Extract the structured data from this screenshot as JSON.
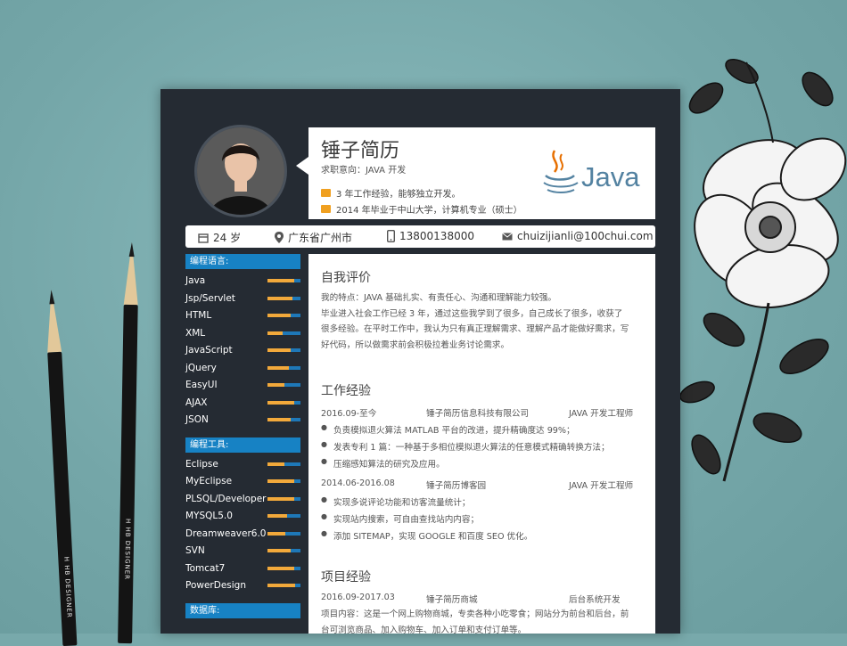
{
  "header": {
    "name": "锤子简历",
    "intent": "求职意向：JAVA 开发",
    "highlights": [
      "3 年工作经验，能够独立开发。",
      "2014 年毕业于中山大学，计算机专业（硕士）"
    ],
    "logo_text": "Java"
  },
  "contact": {
    "age": "24 岁",
    "location": "广东省广州市",
    "phone": "13800138000",
    "email": "chuizijianli@100chui.com"
  },
  "skills": [
    {
      "title": "编程语言:",
      "items": [
        {
          "name": "Java",
          "level": 0.8
        },
        {
          "name": "Jsp/Servlet",
          "level": 0.75
        },
        {
          "name": "HTML",
          "level": 0.7
        },
        {
          "name": "XML",
          "level": 0.45
        },
        {
          "name": "JavaScript",
          "level": 0.7
        },
        {
          "name": "jQuery",
          "level": 0.65
        },
        {
          "name": "EasyUI",
          "level": 0.5
        },
        {
          "name": "AJAX",
          "level": 0.8
        },
        {
          "name": "JSON",
          "level": 0.7
        }
      ]
    },
    {
      "title": "编程工具:",
      "items": [
        {
          "name": "Eclipse",
          "level": 0.5
        },
        {
          "name": "MyEclipse",
          "level": 0.8
        },
        {
          "name": "PLSQL/Developer",
          "level": 0.8
        },
        {
          "name": "MYSQL5.0",
          "level": 0.6
        },
        {
          "name": "Dreamweaver6.0",
          "level": 0.55
        },
        {
          "name": "SVN",
          "level": 0.7
        },
        {
          "name": "Tomcat7",
          "level": 0.8
        },
        {
          "name": "PowerDesign",
          "level": 0.85
        }
      ]
    },
    {
      "title": "数据库:",
      "items": []
    }
  ],
  "self_eval": {
    "title": "自我评价",
    "lines": [
      "我的特点：JAVA 基础扎实、有责任心、沟通和理解能力较强。",
      "毕业进入社会工作已经 3 年，通过这些我学到了很多，自己成长了很多，收获了",
      "很多经验。在平时工作中，我认为只有真正理解需求、理解产品才能做好需求，写",
      "好代码，所以做需求前会积极拉着业务讨论需求。"
    ]
  },
  "work": {
    "title": "工作经验",
    "jobs": [
      {
        "period": "2016.09-至今",
        "company": "锤子简历信息科技有限公司",
        "role": "JAVA 开发工程师",
        "bullets": [
          "负责模拟退火算法 MATLAB 平台的改进，提升精确度达 99%；",
          "发表专利 1 篇：一种基于多相位模拟退火算法的任意模式精确转换方法；",
          "压缩感知算法的研究及应用。"
        ]
      },
      {
        "period": "2014.06-2016.08",
        "company": "锤子简历博客园",
        "role": "JAVA 开发工程师",
        "bullets": [
          "实现多说评论功能和访客流量统计；",
          "实现站内搜索，可自由查找站内内容；",
          "添加 SITEMAP，实现 GOOGLE 和百度 SEO 优化。"
        ]
      }
    ]
  },
  "project": {
    "title": "项目经验",
    "period": "2016.09-2017.03",
    "name": "锤子简历商城",
    "role": "后台系统开发",
    "lines": [
      "项目内容：这是一个网上购物商城，专卖各种小吃零食；网站分为前台和后台，前",
      "台可浏览商品、加入购物车、加入订单和支付订单等。"
    ]
  },
  "pencil_text": "H  HB DESIGNER",
  "colors": {
    "accent": "#1782c4",
    "bar_fill": "#f2a93b",
    "paper": "#252b33"
  }
}
